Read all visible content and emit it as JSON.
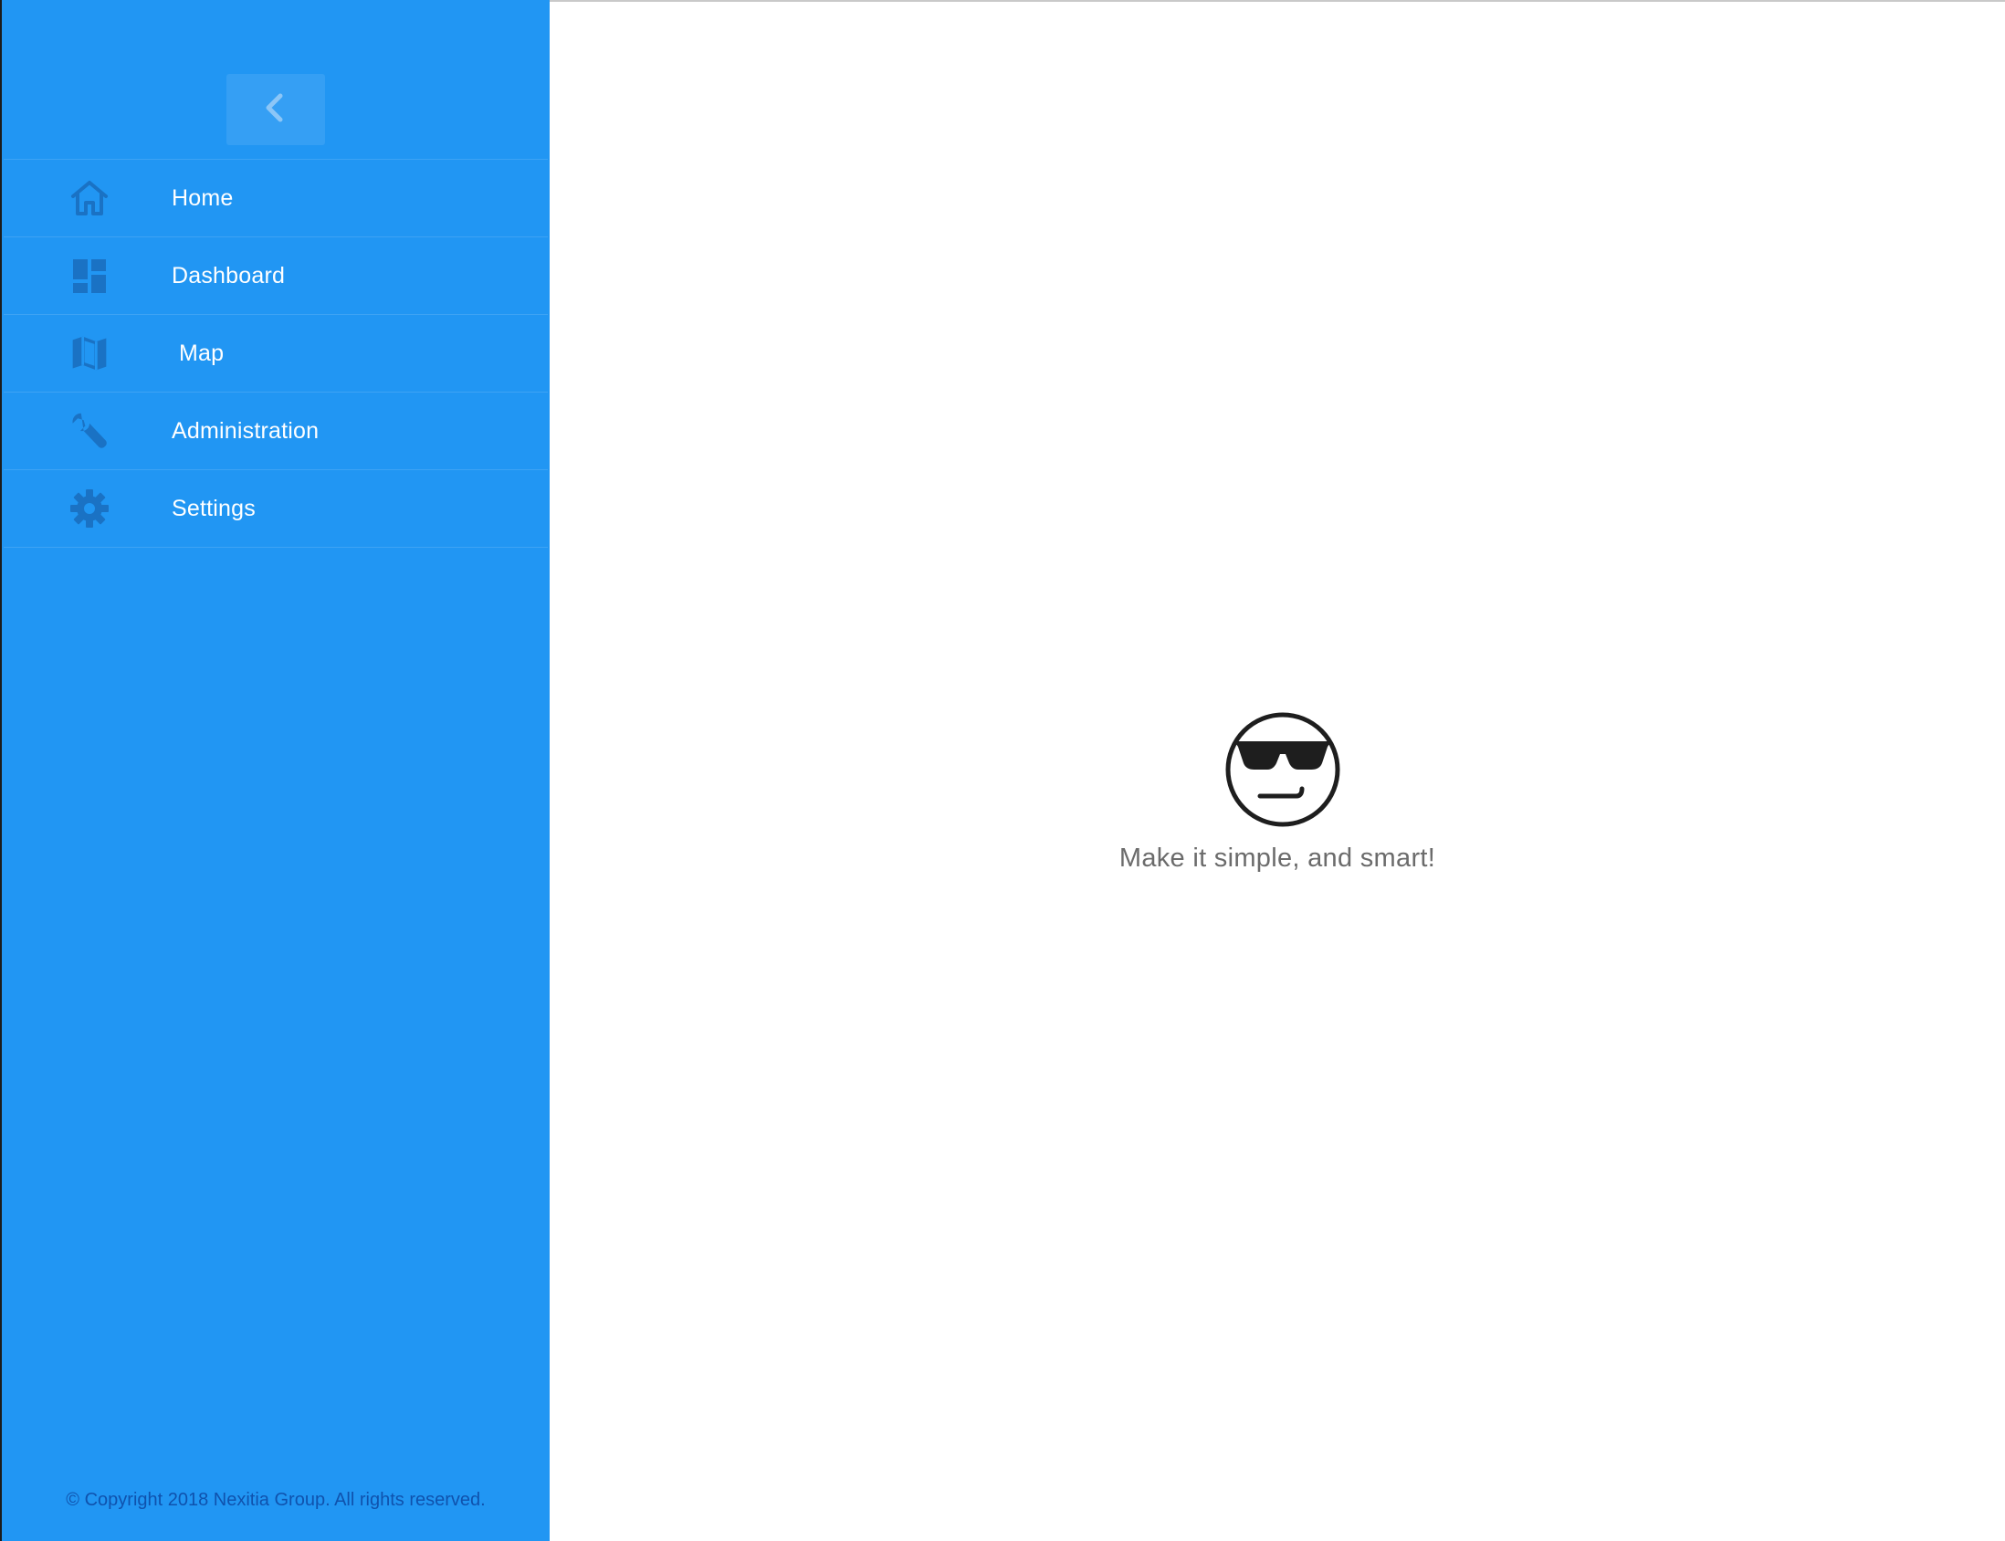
{
  "sidebar": {
    "collapse_icon": "chevron-left-icon",
    "background_color": "#2196f3",
    "icon_color": "#1a72c4",
    "items": [
      {
        "label": "Home",
        "icon": "home-icon"
      },
      {
        "label": "Dashboard",
        "icon": "dashboard-icon"
      },
      {
        "label": "Map",
        "icon": "map-icon"
      },
      {
        "label": "Administration",
        "icon": "wrench-icon"
      },
      {
        "label": "Settings",
        "icon": "gear-icon"
      }
    ],
    "copyright": "© Copyright 2018 Nexitia Group. All rights reserved."
  },
  "main": {
    "emoji_icon": "sunglasses-face-icon",
    "tagline": "Make it simple, and smart!"
  }
}
